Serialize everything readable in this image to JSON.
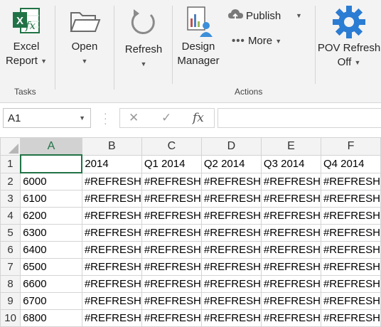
{
  "ribbon": {
    "excel_report": {
      "line1": "Excel",
      "line2": "Report",
      "icon": "excel-fx-icon"
    },
    "open": {
      "label": "Open",
      "icon": "folder-open-icon"
    },
    "refresh": {
      "label": "Refresh",
      "icon": "refresh-icon"
    },
    "design_manager": {
      "line1": "Design",
      "line2": "Manager",
      "icon": "design-manager-icon"
    },
    "publish": {
      "label": "Publish",
      "icon": "cloud-publish-icon"
    },
    "more": {
      "label": "More",
      "icon": "more-dots-icon"
    },
    "pov_refresh": {
      "line1": "POV Refresh",
      "line2": "Off",
      "icon": "gear-icon"
    },
    "groups": {
      "tasks": "Tasks",
      "actions": "Actions"
    }
  },
  "formula_bar": {
    "name_box": "A1",
    "cancel_glyph": "✕",
    "enter_glyph": "✓",
    "fx_glyph": "fx",
    "formula": ""
  },
  "sheet": {
    "columns": [
      "A",
      "B",
      "C",
      "D",
      "E",
      "F"
    ],
    "selected_column": "A",
    "rows": [
      {
        "num": "1",
        "cells": [
          "",
          "2014",
          "Q1 2014",
          "Q2 2014",
          "Q3 2014",
          "Q4 2014"
        ]
      },
      {
        "num": "2",
        "cells": [
          "6000",
          "#REFRESH",
          "#REFRESH",
          "#REFRESH",
          "#REFRESH",
          "#REFRESH"
        ]
      },
      {
        "num": "3",
        "cells": [
          "6100",
          "#REFRESH",
          "#REFRESH",
          "#REFRESH",
          "#REFRESH",
          "#REFRESH"
        ]
      },
      {
        "num": "4",
        "cells": [
          "6200",
          "#REFRESH",
          "#REFRESH",
          "#REFRESH",
          "#REFRESH",
          "#REFRESH"
        ]
      },
      {
        "num": "5",
        "cells": [
          "6300",
          "#REFRESH",
          "#REFRESH",
          "#REFRESH",
          "#REFRESH",
          "#REFRESH"
        ]
      },
      {
        "num": "6",
        "cells": [
          "6400",
          "#REFRESH",
          "#REFRESH",
          "#REFRESH",
          "#REFRESH",
          "#REFRESH"
        ]
      },
      {
        "num": "7",
        "cells": [
          "6500",
          "#REFRESH",
          "#REFRESH",
          "#REFRESH",
          "#REFRESH",
          "#REFRESH"
        ]
      },
      {
        "num": "8",
        "cells": [
          "6600",
          "#REFRESH",
          "#REFRESH",
          "#REFRESH",
          "#REFRESH",
          "#REFRESH"
        ]
      },
      {
        "num": "9",
        "cells": [
          "6700",
          "#REFRESH",
          "#REFRESH",
          "#REFRESH",
          "#REFRESH",
          "#REFRESH"
        ]
      },
      {
        "num": "10",
        "cells": [
          "6800",
          "#REFRESH",
          "#REFRESH",
          "#REFRESH",
          "#REFRESH",
          "#REFRESH"
        ]
      }
    ]
  },
  "colors": {
    "excel_green": "#217346",
    "gear_blue": "#2b7cd3",
    "person_blue": "#3c8fd9"
  }
}
